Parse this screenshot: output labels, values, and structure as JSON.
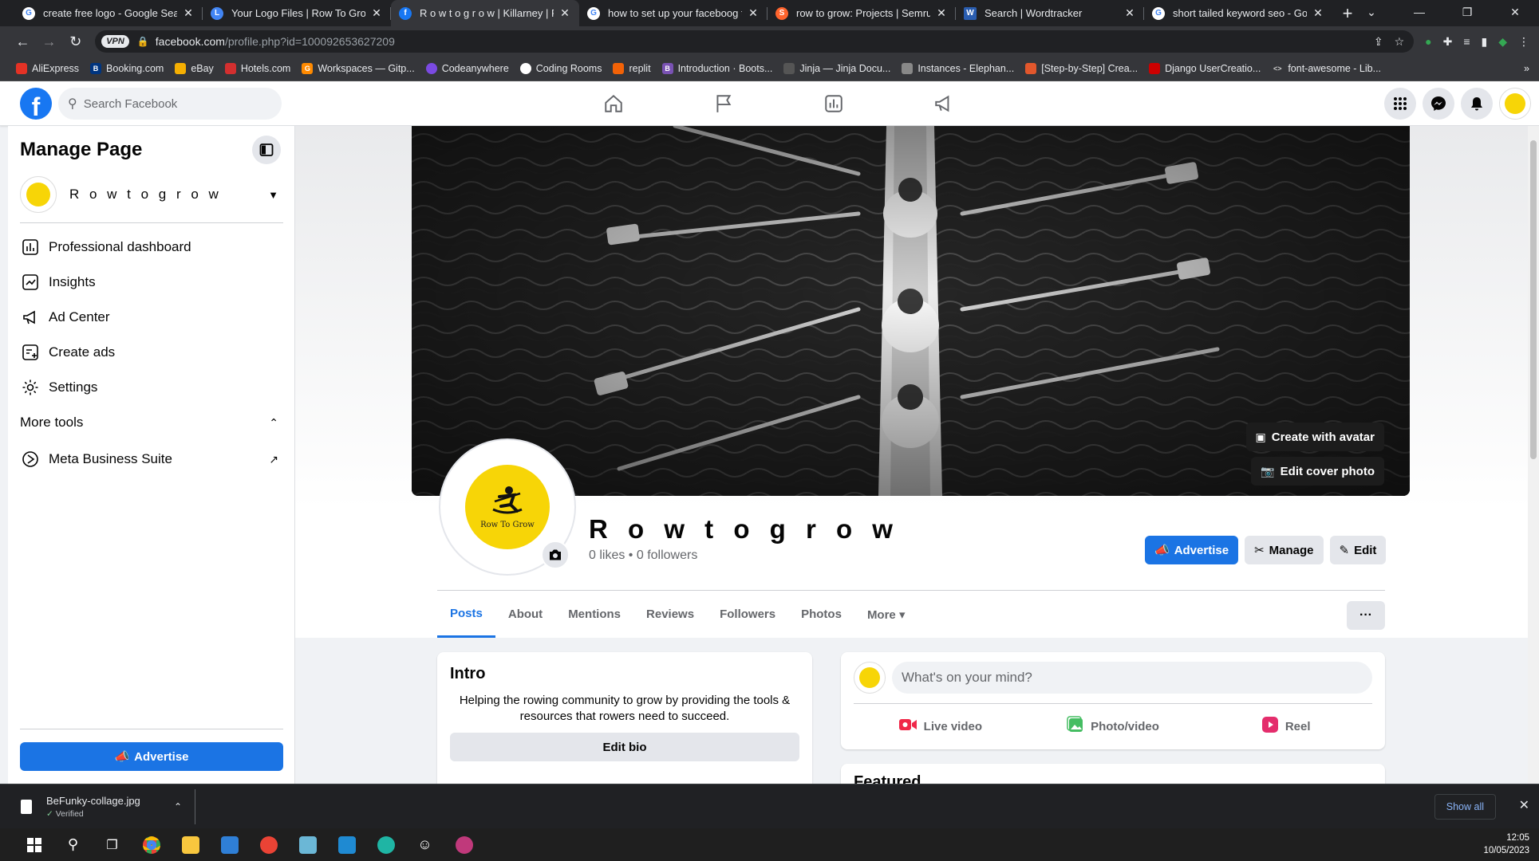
{
  "browser": {
    "tabs": [
      {
        "title": "create free logo - Google Search",
        "icon": "google-icon",
        "color": "#ffffff"
      },
      {
        "title": "Your Logo Files | Row To Grow |",
        "icon": "logo-site-icon",
        "color": "#4285f4"
      },
      {
        "title": "R o w t o g r o w | Killarney | Fac",
        "icon": "facebook-icon",
        "color": "#1877f2",
        "active": true
      },
      {
        "title": "how to set up your faceboog to",
        "icon": "google-icon",
        "color": "#ffffff"
      },
      {
        "title": "row to grow: Projects | Semrush",
        "icon": "semrush-icon",
        "color": "#ff642d"
      },
      {
        "title": "Search | Wordtracker",
        "icon": "wordtracker-icon",
        "color": "#2a5db0"
      },
      {
        "title": "short tailed keyword seo - Goog",
        "icon": "google-icon",
        "color": "#ffffff"
      }
    ],
    "vpn_label": "VPN",
    "url_host": "facebook.com",
    "url_path": "/profile.php?id=100092653627209",
    "bookmarks": [
      {
        "label": "AliExpress",
        "color": "#e43225"
      },
      {
        "label": "Booking.com",
        "color": "#003580"
      },
      {
        "label": "eBay",
        "color": "#f5af02"
      },
      {
        "label": "Hotels.com",
        "color": "#d32f2f"
      },
      {
        "label": "Workspaces — Gitp...",
        "color": "#ff8a00"
      },
      {
        "label": "Codeanywhere",
        "color": "#7b4ae2"
      },
      {
        "label": "Coding Rooms",
        "color": "#ffffff"
      },
      {
        "label": "replit",
        "color": "#f26207"
      },
      {
        "label": "Introduction · Boots...",
        "color": "#7952b3"
      },
      {
        "label": "Jinja — Jinja Docu...",
        "color": "#555555"
      },
      {
        "label": "Instances - Elephan...",
        "color": "#888888"
      },
      {
        "label": "[Step-by-Step] Crea...",
        "color": "#e2572c"
      },
      {
        "label": "Django UserCreatio...",
        "color": "#cc0000"
      },
      {
        "label": "font-awesome - Lib...",
        "color": "#999999"
      }
    ]
  },
  "fb": {
    "search_placeholder": "Search Facebook",
    "accent": "#1b74e4"
  },
  "sidebar": {
    "title": "Manage Page",
    "page_name": "R o w t o g r o w",
    "items": [
      {
        "label": "Professional dashboard",
        "icon": "dashboard-icon"
      },
      {
        "label": "Insights",
        "icon": "insights-icon"
      },
      {
        "label": "Ad Center",
        "icon": "megaphone-icon"
      },
      {
        "label": "Create ads",
        "icon": "create-ads-icon"
      },
      {
        "label": "Settings",
        "icon": "gear-icon"
      }
    ],
    "more_tools": "More tools",
    "meta_suite": "Meta Business Suite",
    "advertise": "Advertise"
  },
  "profile": {
    "cover_buttons": {
      "avatar": "Create with avatar",
      "cover": "Edit cover photo"
    },
    "avatar_brand": "Row To Grow",
    "name": "R o w t o g r o w",
    "stats": "0 likes • 0 followers",
    "actions": {
      "advertise": "Advertise",
      "manage": "Manage",
      "edit": "Edit"
    },
    "tabs": [
      "Posts",
      "About",
      "Mentions",
      "Reviews",
      "Followers",
      "Photos",
      "More ▾"
    ],
    "more_dots": "···"
  },
  "intro": {
    "title": "Intro",
    "bio": "Helping the rowing community to grow by providing the tools & resources that rowers need to succeed.",
    "edit_bio": "Edit bio"
  },
  "composer": {
    "placeholder": "What's on your mind?",
    "live": "Live video",
    "photo": "Photo/video",
    "reel": "Reel"
  },
  "featured": {
    "title": "Featured"
  },
  "downloads": {
    "file": "BeFunky-collage.jpg",
    "status": "Verified",
    "show_all": "Show all"
  },
  "clock": {
    "time": "12:05",
    "date": "10/05/2023"
  }
}
